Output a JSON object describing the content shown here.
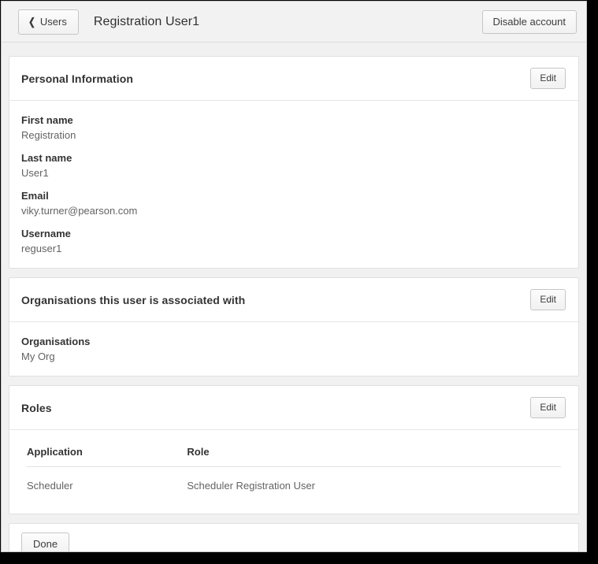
{
  "header": {
    "back_button": {
      "label": "Users",
      "icon": "chevron-left-icon"
    },
    "title": "Registration User1",
    "disable_account_button": "Disable account"
  },
  "panels": {
    "personal_information": {
      "title": "Personal Information",
      "edit_label": "Edit",
      "fields": [
        {
          "label": "First name",
          "value": "Registration"
        },
        {
          "label": "Last name",
          "value": "User1"
        },
        {
          "label": "Email",
          "value": "viky.turner@pearson.com"
        },
        {
          "label": "Username",
          "value": "reguser1"
        }
      ]
    },
    "organisations": {
      "title": "Organisations this user is associated with",
      "edit_label": "Edit",
      "fields": [
        {
          "label": "Organisations",
          "value": "My Org"
        }
      ]
    },
    "roles": {
      "title": "Roles",
      "edit_label": "Edit",
      "columns": [
        "Application",
        "Role"
      ],
      "rows": [
        {
          "application": "Scheduler",
          "role": "Scheduler Registration User"
        }
      ]
    }
  },
  "footer": {
    "done_button": "Done"
  },
  "colors": {
    "page_background": "#f1f1f1",
    "panel_background": "#ffffff",
    "panel_border": "#e0e0e0",
    "label_text": "#333333",
    "value_text": "#636363",
    "button_border": "#c6c6c6"
  }
}
